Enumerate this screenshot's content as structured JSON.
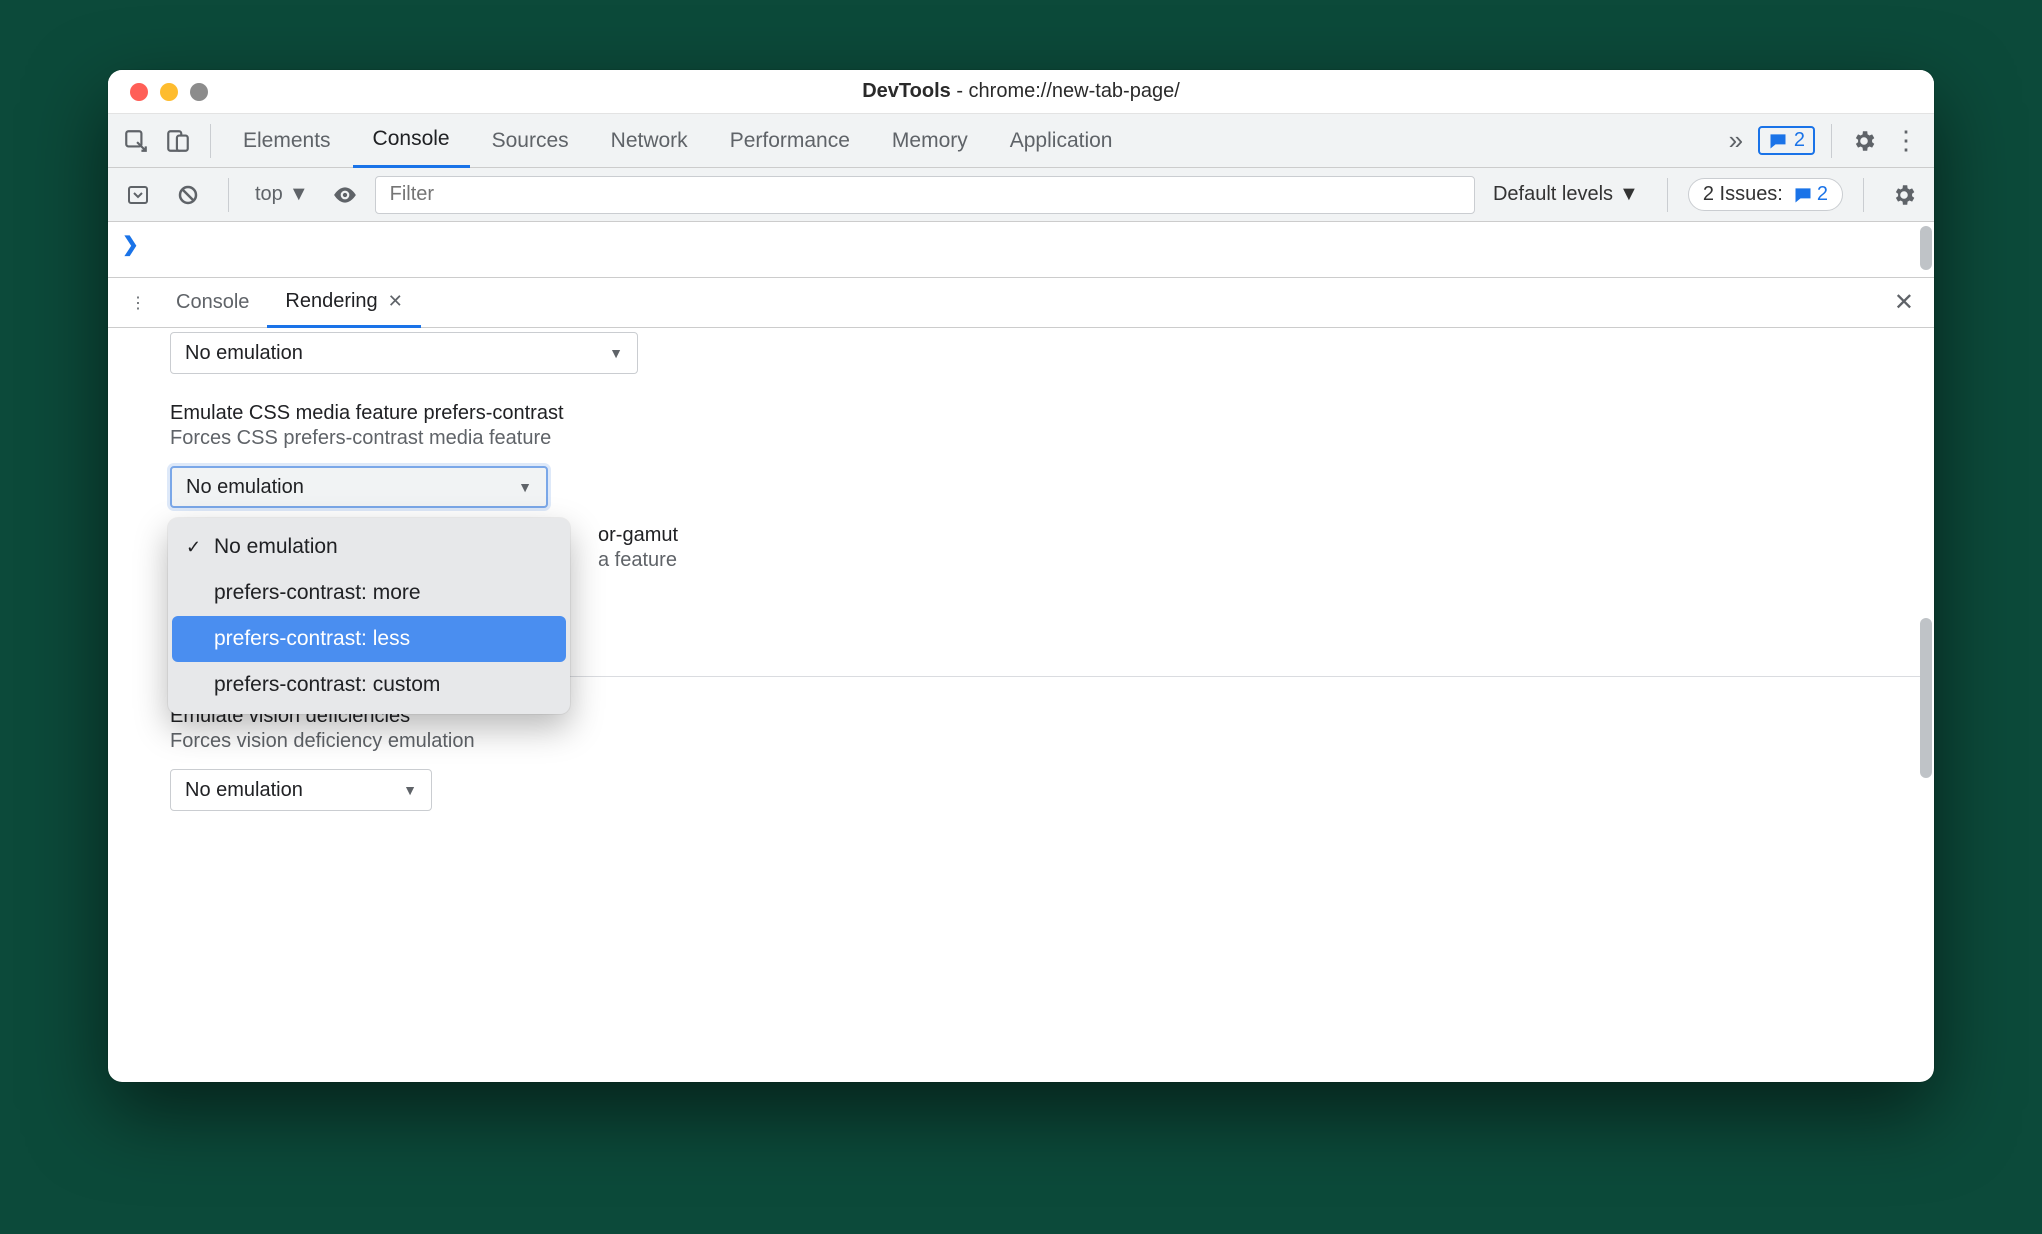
{
  "window": {
    "title_prefix": "DevTools",
    "title_separator": " - ",
    "title_url": "chrome://new-tab-page/"
  },
  "traffic_colors": {
    "close": "#ff5f57",
    "min": "#febc2e",
    "max": "#8c8c8c"
  },
  "top_tabs": {
    "items": [
      "Elements",
      "Console",
      "Sources",
      "Network",
      "Performance",
      "Memory",
      "Application"
    ],
    "active_index": 1
  },
  "top_badge": {
    "count": "2"
  },
  "toolbar": {
    "context": "top",
    "filter_placeholder": "Filter",
    "levels_label": "Default levels",
    "issues_label": "2 Issues:",
    "issues_count": "2"
  },
  "drawer": {
    "tabs": [
      "Console",
      "Rendering"
    ],
    "active_index": 1
  },
  "rendering": {
    "top_select": "No emulation",
    "contrast": {
      "title": "Emulate CSS media feature prefers-contrast",
      "subtitle": "Forces CSS prefers-contrast media feature",
      "select_value": "No emulation",
      "options": [
        "No emulation",
        "prefers-contrast: more",
        "prefers-contrast: less",
        "prefers-contrast: custom"
      ],
      "checked_index": 0,
      "hover_index": 2
    },
    "gamut": {
      "title_suffix": "or-gamut",
      "subtitle_suffix": "a feature"
    },
    "vision": {
      "title": "Emulate vision deficiencies",
      "subtitle": "Forces vision deficiency emulation",
      "select_value": "No emulation"
    }
  }
}
